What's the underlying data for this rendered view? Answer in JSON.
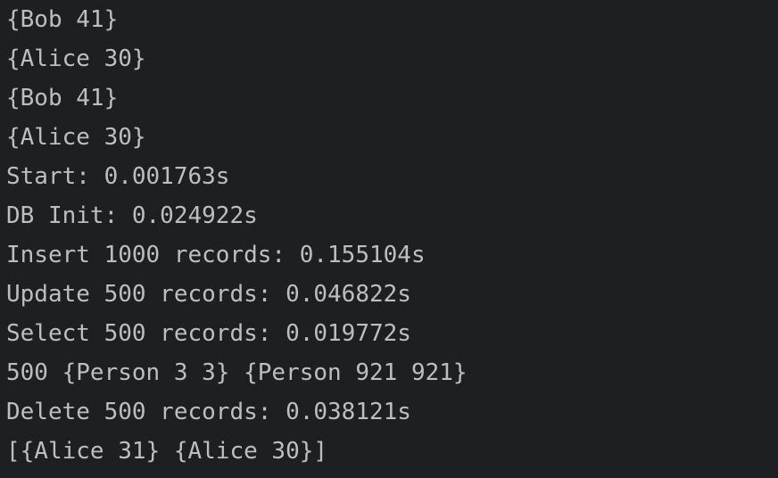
{
  "console": {
    "lines": [
      "{Bob 41}",
      "{Alice 30}",
      "{Bob 41}",
      "{Alice 30}",
      "Start: 0.001763s",
      "DB Init: 0.024922s",
      "Insert 1000 records: 0.155104s",
      "Update 500 records: 0.046822s",
      "Select 500 records: 0.019772s",
      "500 {Person 3 3} {Person 921 921}",
      "Delete 500 records: 0.038121s",
      "[{Alice 31} {Alice 30}]"
    ]
  },
  "colors": {
    "background": "#1e1f22",
    "text": "#bcbec4"
  }
}
